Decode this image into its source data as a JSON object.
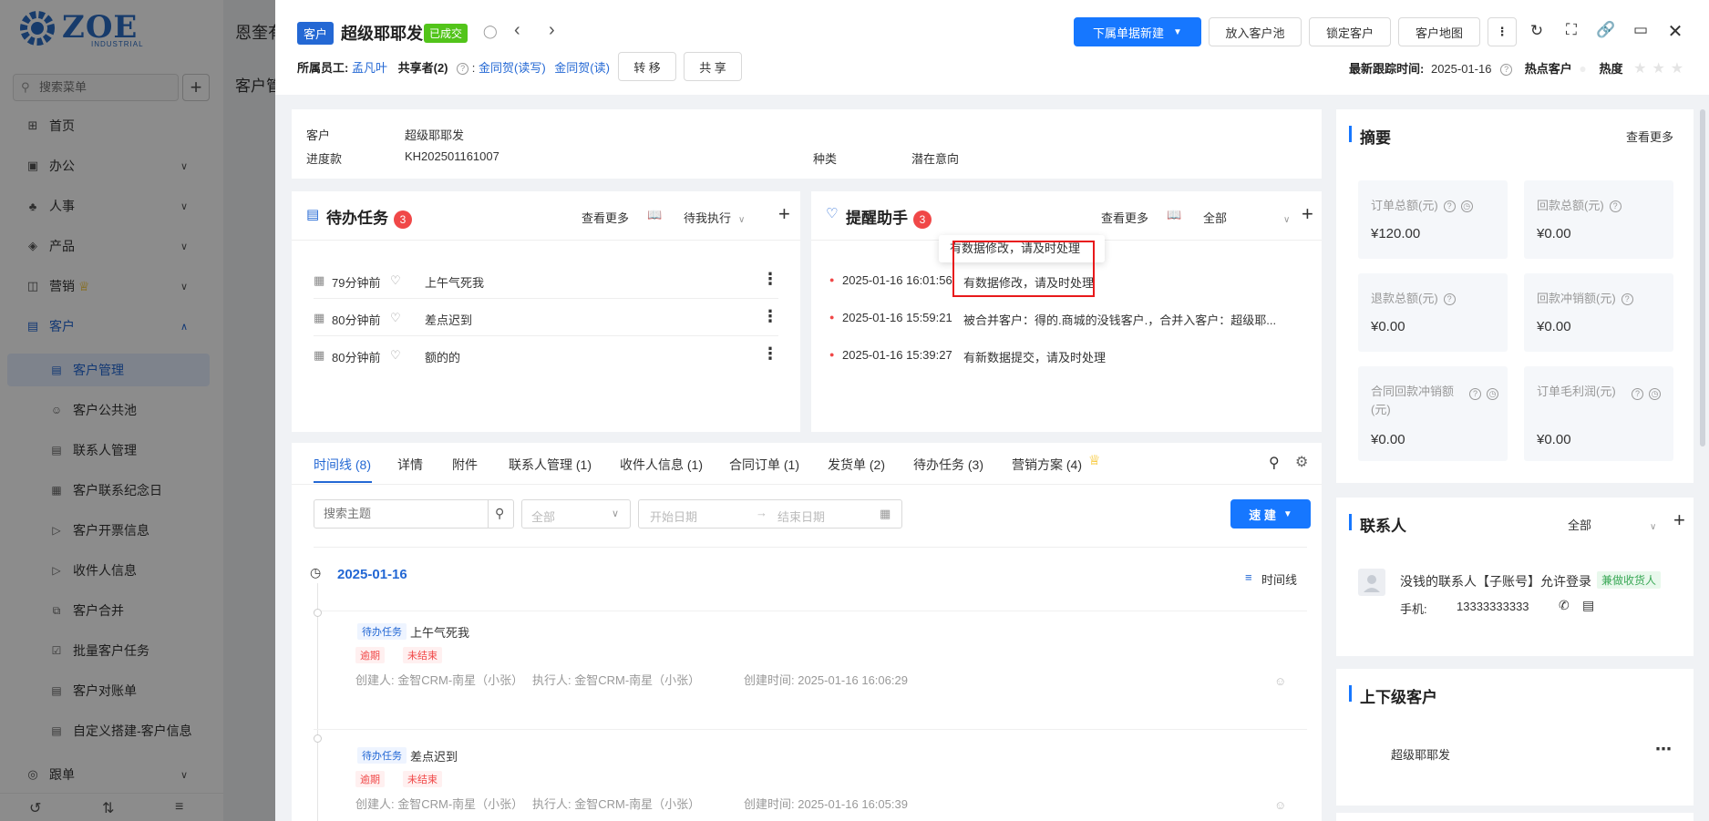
{
  "sidebar": {
    "logo_text": "ZOE",
    "logo_sub": "INDUSTRIAL",
    "search_placeholder": "搜索菜单",
    "items": [
      {
        "label": "首页",
        "icon": "home-icon"
      },
      {
        "label": "办公",
        "icon": "briefcase-icon"
      },
      {
        "label": "人事",
        "icon": "people-icon"
      },
      {
        "label": "产品",
        "icon": "box-icon"
      },
      {
        "label": "营销",
        "icon": "megaphone-icon"
      },
      {
        "label": "客户",
        "icon": "chart-icon"
      }
    ],
    "sub_items": [
      "客户管理",
      "客户公共池",
      "联系人管理",
      "客户联系纪念日",
      "客户开票信息",
      "收件人信息",
      "客户合并",
      "批量客户任务",
      "客户对账单",
      "自定义搭建-客户信息"
    ],
    "bottom_item": "跟单"
  },
  "background": {
    "header_title": "恩奎有",
    "crumb": "客户管"
  },
  "header": {
    "type_tag": "客户",
    "customer_name": "超级耶耶发",
    "status_tag": "已成交",
    "owner_label": "所属员工:",
    "owner_name": "孟凡叶",
    "sharer_label": "共享者(2)",
    "sharer_sep": ":",
    "sharer_1": "金同贺(读写)",
    "sharer_2": "金同贺(读)",
    "transfer_btn": "转 移",
    "share_btn": "共 享",
    "new_sub_btn": "下属单据新建",
    "pool_btn": "放入客户池",
    "lock_btn": "锁定客户",
    "map_btn": "客户地图",
    "last_follow_label": "最新跟踪时间:",
    "last_follow_date": "2025-01-16",
    "hot_label": "热点客户",
    "heat_label": "热度",
    "heat_stars": "★★★"
  },
  "info": {
    "customer_label": "客户",
    "customer_value": "超级耶耶发",
    "progress_label": "进度款",
    "progress_value": "KH202501161007",
    "kind_label": "种类",
    "kind_value": "潜在意向"
  },
  "todo": {
    "title": "待办任务",
    "count": "3",
    "more": "查看更多",
    "filter": "待我执行",
    "items": [
      {
        "time": "79分钟前",
        "text": "上午气死我"
      },
      {
        "time": "80分钟前",
        "text": "差点迟到"
      },
      {
        "time": "80分钟前",
        "text": "额的的"
      }
    ]
  },
  "reminder": {
    "title": "提醒助手",
    "count": "3",
    "more": "查看更多",
    "filter": "全部",
    "tooltip": "有数据修改，请及时处理",
    "items": [
      {
        "time": "2025-01-16 16:01:56",
        "text": "有数据修改，请及时处理"
      },
      {
        "time": "2025-01-16 15:59:21",
        "text": "被合并客户：得的.商城的没钱客户.，合并入客户：超级耶..."
      },
      {
        "time": "2025-01-16 15:39:27",
        "text": "有新数据提交，请及时处理"
      }
    ]
  },
  "tabs": [
    "时间线 (8)",
    "详情",
    "附件",
    "联系人管理 (1)",
    "收件人信息 (1)",
    "合同订单 (1)",
    "发货单 (2)",
    "待办任务 (3)",
    "营销方案 (4)"
  ],
  "filters": {
    "search_placeholder": "搜索主题",
    "all": "全部",
    "start_placeholder": "开始日期",
    "end_placeholder": "结束日期",
    "quick_btn": "速 建"
  },
  "timeline": {
    "date": "2025-01-16",
    "view_label": "时间线",
    "entries": [
      {
        "tag": "待办任务",
        "title": "上午气死我",
        "tag2": "逾期",
        "tag3": "未结束",
        "creator": "创建人: 金智CRM-南星（小张）",
        "executor": "执行人: 金智CRM-南星（小张）",
        "created": "创建时间: 2025-01-16 16:06:29"
      },
      {
        "tag": "待办任务",
        "title": "差点迟到",
        "tag2": "逾期",
        "tag3": "未结束",
        "creator": "创建人: 金智CRM-南星（小张）",
        "executor": "执行人: 金智CRM-南星（小张）",
        "created": "创建时间: 2025-01-16 16:05:39"
      }
    ]
  },
  "summary": {
    "title": "摘要",
    "more": "查看更多",
    "stats": [
      {
        "label": "订单总额(元)",
        "value": "¥120.00"
      },
      {
        "label": "回款总额(元)",
        "value": "¥0.00"
      },
      {
        "label": "退款总额(元)",
        "value": "¥0.00"
      },
      {
        "label": "回款冲销额(元)",
        "value": "¥0.00"
      },
      {
        "label": "合同回款冲销额(元)",
        "value": "¥0.00"
      },
      {
        "label": "订单毛利润(元)",
        "value": "¥0.00"
      }
    ]
  },
  "contacts": {
    "title": "联系人",
    "filter": "全部",
    "name": "没钱的联系人【子账号】允许登录",
    "tag": "兼做收货人",
    "phone_label": "手机:",
    "phone": "13333333333"
  },
  "hierarchy": {
    "title": "上下级客户",
    "item": "超级耶耶发"
  },
  "colors": {
    "primary": "#2468d4",
    "danger": "#f04848",
    "success": "#52c41a"
  }
}
